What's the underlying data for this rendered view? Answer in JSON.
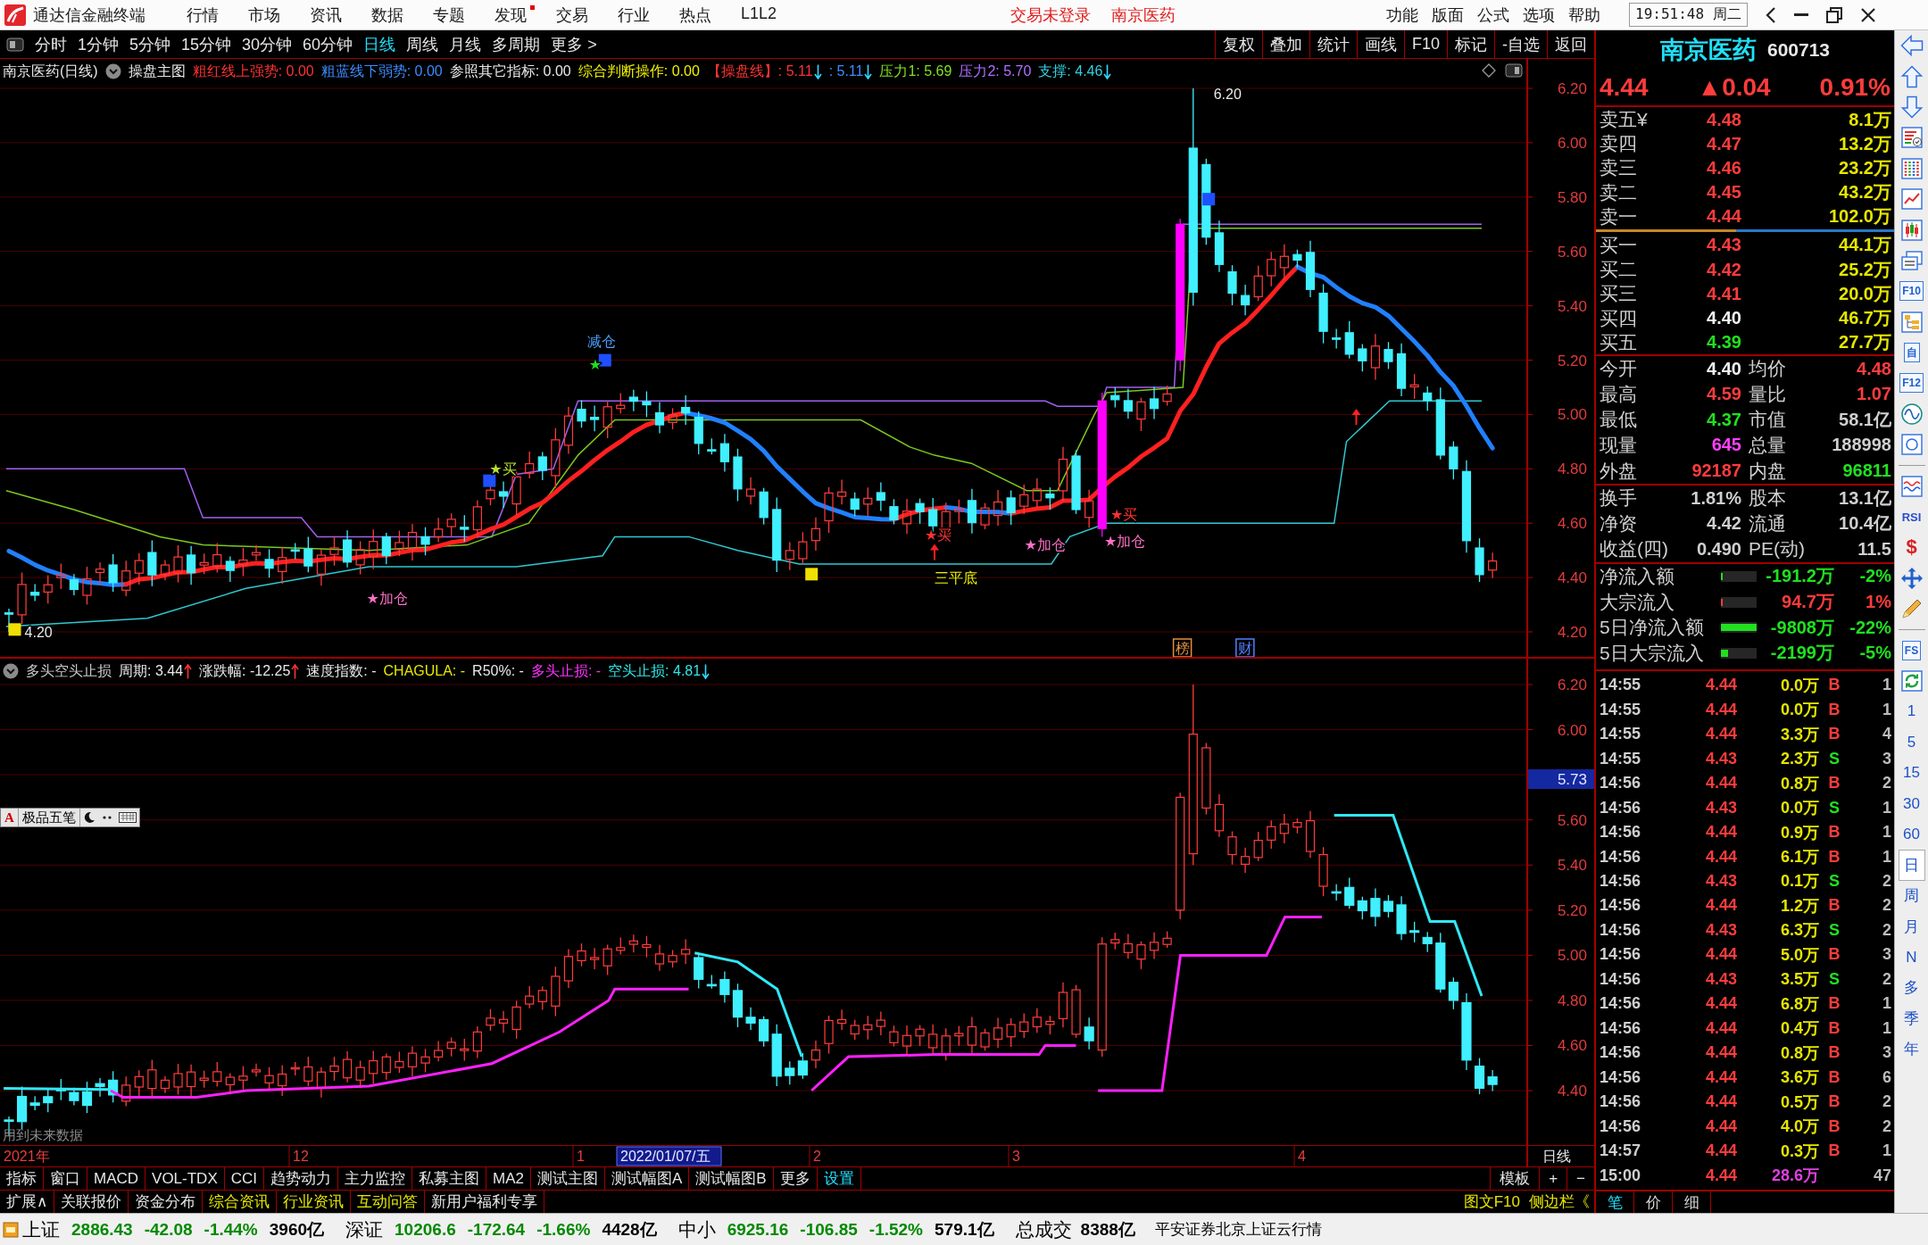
{
  "title_bar": {
    "app_name": "通达信金融终端",
    "menus": [
      {
        "label": "行情",
        "badge": false
      },
      {
        "label": "市场",
        "badge": false
      },
      {
        "label": "资讯",
        "badge": false
      },
      {
        "label": "数据",
        "badge": false
      },
      {
        "label": "专题",
        "badge": false
      },
      {
        "label": "发现",
        "badge": true
      },
      {
        "label": "交易",
        "badge": false
      },
      {
        "label": "行业",
        "badge": false
      },
      {
        "label": "热点",
        "badge": false
      },
      {
        "label": "L1L2",
        "badge": false
      }
    ],
    "notices": [
      "交易未登录",
      "南京医药"
    ],
    "system_menus": [
      "功能",
      "版面",
      "公式",
      "选项",
      "帮助"
    ],
    "clock": "19:51:48 周二"
  },
  "toolbar": {
    "periods": [
      {
        "label": "分时",
        "selected": false
      },
      {
        "label": "1分钟",
        "selected": false
      },
      {
        "label": "5分钟",
        "selected": false
      },
      {
        "label": "15分钟",
        "selected": false
      },
      {
        "label": "30分钟",
        "selected": false
      },
      {
        "label": "60分钟",
        "selected": false
      },
      {
        "label": "日线",
        "selected": true
      },
      {
        "label": "周线",
        "selected": false
      },
      {
        "label": "月线",
        "selected": false
      },
      {
        "label": "多周期",
        "selected": false
      },
      {
        "label": "更多 >",
        "selected": false
      }
    ],
    "tools": [
      "复权",
      "叠加",
      "统计",
      "画线",
      "F10",
      "标记",
      "-自选",
      "返回"
    ]
  },
  "main_chart": {
    "title": "南京医药(日线)",
    "formula": "操盘主图",
    "readouts": [
      {
        "text": "粗红线上强势: 0.00",
        "color": "#ff3232",
        "kind": "plain"
      },
      {
        "text": "粗蓝线下弱势: 0.00",
        "color": "#3c8cff",
        "kind": "plain"
      },
      {
        "text": "参照其它指标: 0.00",
        "color": "#e8e8e8",
        "kind": "plain"
      },
      {
        "text": "综合判断操作: 0.00",
        "color": "#f0f000",
        "kind": "plain"
      },
      {
        "text": "【操盘线】: 5.11",
        "color": "#ff3232",
        "kind": "falling"
      },
      {
        "text": ": 5.11",
        "color": "#3c8cff",
        "kind": "falling"
      },
      {
        "text": "压力1: 5.69",
        "color": "#80e020",
        "kind": "plain"
      },
      {
        "text": "压力2: 5.70",
        "color": "#b070ff",
        "kind": "plain"
      },
      {
        "text": "支撑: 4.46",
        "color": "#30d0e0",
        "kind": "falling"
      }
    ],
    "price_axis": [
      "6.20",
      "6.00",
      "5.80",
      "5.60",
      "5.40",
      "5.20",
      "5.00",
      "4.80",
      "4.60",
      "4.40",
      "4.20"
    ],
    "annotations": [
      {
        "kind": "price",
        "text": "6.20",
        "color": "#e8e8e8"
      },
      {
        "kind": "signal",
        "text": "减仓",
        "color": "#4aa0ff"
      },
      {
        "kind": "signal",
        "text": "★",
        "color": "#20e020"
      },
      {
        "kind": "signal",
        "text": "★买",
        "color": "#b8e030"
      },
      {
        "kind": "signal",
        "text": "★买",
        "color": "#ff3030"
      },
      {
        "kind": "signal",
        "text": "★买",
        "color": "#ff3030"
      },
      {
        "kind": "signal",
        "text": "★加仓",
        "color": "#ff70c8"
      },
      {
        "kind": "signal",
        "text": "★加仓",
        "color": "#ff70c8"
      },
      {
        "kind": "signal",
        "text": "三平底",
        "color": "#f0f000"
      },
      {
        "kind": "signal",
        "text": "★加仓",
        "color": "#ff70c8"
      },
      {
        "kind": "price",
        "text": "4.20",
        "color": "#e8e8e8"
      },
      {
        "kind": "tile",
        "text": "榜",
        "color": "#e09040"
      },
      {
        "kind": "tile",
        "text": "财",
        "color": "#5080ff"
      }
    ]
  },
  "lower_chart": {
    "title": "多头空头止损",
    "readouts": [
      {
        "text": "周期: 3.44",
        "color": "#e8e8e8",
        "kind": "rising"
      },
      {
        "text": "涨跌幅: -12.25",
        "color": "#e8e8e8",
        "kind": "rising"
      },
      {
        "text": "速度指数: -",
        "color": "#e8e8e8",
        "kind": "plain"
      },
      {
        "text": "CHAGULA: -",
        "color": "#e6e600",
        "kind": "plain"
      },
      {
        "text": "R50%: -",
        "color": "#e8e8e8",
        "kind": "plain"
      },
      {
        "text": "多头止损: -",
        "color": "#ff30ff",
        "kind": "plain"
      },
      {
        "text": "空头止损: 4.81",
        "color": "#30e6e6",
        "kind": "falling"
      }
    ],
    "price_axis": [
      "6.20",
      "6.00",
      "5.60",
      "5.40",
      "5.20",
      "5.00",
      "4.80",
      "4.60",
      "4.40"
    ],
    "cursor_price": "5.73",
    "footnote": "用到未来数据"
  },
  "ime_bar": {
    "mode": "A",
    "name": "极品五笔"
  },
  "date_axis": {
    "labels": [
      {
        "text": "2021年",
        "kind": "tick"
      },
      {
        "text": "12",
        "kind": "tick"
      },
      {
        "text": "1",
        "kind": "tick"
      },
      {
        "text": "2022/01/07/五",
        "kind": "cursor"
      },
      {
        "text": "2",
        "kind": "tick"
      },
      {
        "text": "3",
        "kind": "tick"
      },
      {
        "text": "4",
        "kind": "tick"
      }
    ],
    "period": "日线"
  },
  "indicator_tabs": {
    "tabs": [
      {
        "label": "指标",
        "kind": "tab"
      },
      {
        "label": "窗口",
        "kind": "tab"
      },
      {
        "label": "MACD",
        "kind": "tab"
      },
      {
        "label": "VOL-TDX",
        "kind": "tab"
      },
      {
        "label": "CCI",
        "kind": "tab"
      },
      {
        "label": "趋势动力",
        "kind": "tab"
      },
      {
        "label": "主力监控",
        "kind": "tab"
      },
      {
        "label": "私募主图",
        "kind": "tab"
      },
      {
        "label": "MA2",
        "kind": "tab"
      },
      {
        "label": "测试主图",
        "kind": "tab"
      },
      {
        "label": "测试幅图A",
        "kind": "tab"
      },
      {
        "label": "测试幅图B",
        "kind": "tab"
      },
      {
        "label": "更多",
        "kind": "tab"
      },
      {
        "label": "设置",
        "kind": "link"
      }
    ],
    "actions": [
      "模板",
      "+",
      "−"
    ]
  },
  "info_tabs": {
    "tabs": [
      {
        "label": "扩展∧",
        "kind": "tab"
      },
      {
        "label": "关联报价",
        "kind": "tab"
      },
      {
        "label": "资金分布",
        "kind": "tab"
      },
      {
        "label": "综合资讯",
        "kind": "info"
      },
      {
        "label": "行业资讯",
        "kind": "info"
      },
      {
        "label": "互动问答",
        "kind": "info"
      },
      {
        "label": "新用户福利专享",
        "kind": "tab"
      }
    ],
    "actions": [
      "图文F10",
      "侧边栏《"
    ]
  },
  "quote_panel": {
    "name": "南京医药",
    "code": "600713",
    "price": "4.44",
    "change": "▲0.04",
    "change_pct": "0.91%",
    "asks": [
      {
        "label": "卖五¥",
        "price": "4.48",
        "volume": "8.1万",
        "color": "#ff3c3c"
      },
      {
        "label": "卖四",
        "price": "4.47",
        "volume": "13.2万",
        "color": "#ff3c3c"
      },
      {
        "label": "卖三",
        "price": "4.46",
        "volume": "23.2万",
        "color": "#ff3c3c"
      },
      {
        "label": "卖二",
        "price": "4.45",
        "volume": "43.2万",
        "color": "#ff3c3c"
      },
      {
        "label": "卖一",
        "price": "4.44",
        "volume": "102.0万",
        "color": "#ff3c3c"
      }
    ],
    "book_ratio": {
      "level": 0.47
    },
    "bids": [
      {
        "label": "买一",
        "price": "4.43",
        "volume": "44.1万",
        "color": "#ff3c3c"
      },
      {
        "label": "买二",
        "price": "4.42",
        "volume": "25.2万",
        "color": "#ff3c3c"
      },
      {
        "label": "买三",
        "price": "4.41",
        "volume": "20.0万",
        "color": "#ff3c3c"
      },
      {
        "label": "买四",
        "price": "4.40",
        "volume": "46.7万",
        "color": "#f2f2f2"
      },
      {
        "label": "买五",
        "price": "4.39",
        "volume": "27.7万",
        "color": "#20e020"
      }
    ],
    "stats": [
      [
        {
          "label": "今开",
          "value": "4.40",
          "color": "#f2f2f2"
        },
        {
          "label": "均价",
          "value": "4.48",
          "color": "#ff3c3c"
        }
      ],
      [
        {
          "label": "最高",
          "value": "4.59",
          "color": "#ff3c3c"
        },
        {
          "label": "量比",
          "value": "1.07",
          "color": "#ff3c3c"
        }
      ],
      [
        {
          "label": "最低",
          "value": "4.37",
          "color": "#20e020"
        },
        {
          "label": "市值",
          "value": "58.1亿",
          "color": "#cfcfcf"
        }
      ],
      [
        {
          "label": "现量",
          "value": "645",
          "color": "#ff40ff"
        },
        {
          "label": "总量",
          "value": "188998",
          "color": "#cfcfcf"
        }
      ],
      [
        {
          "label": "外盘",
          "value": "92187",
          "color": "#ff3c3c"
        },
        {
          "label": "内盘",
          "value": "96811",
          "color": "#20e020"
        }
      ]
    ],
    "ratios": [
      [
        {
          "label": "换手",
          "value": "1.81%"
        },
        {
          "label": "股本",
          "value": "13.1亿"
        }
      ],
      [
        {
          "label": "净资",
          "value": "4.42"
        },
        {
          "label": "流通",
          "value": "10.4亿"
        }
      ],
      [
        {
          "label": "收益(四)",
          "value": "0.490"
        },
        {
          "label": "PE(动)",
          "value": "11.5"
        }
      ]
    ],
    "fund_flows": [
      {
        "label": "净流入额",
        "level": 0.04,
        "amount": "-191.2万",
        "percent": "-2%",
        "color": "#20e020"
      },
      {
        "label": "大宗流入",
        "level": 0.04,
        "amount": "94.7万",
        "percent": "1%",
        "color": "#ff3c3c"
      },
      {
        "label": "5日净流入额",
        "level": 1,
        "amount": "-9808万",
        "percent": "-22%",
        "color": "#20e020"
      },
      {
        "label": "5日大宗流入",
        "level": 0.2,
        "amount": "-2199万",
        "percent": "-5%",
        "color": "#20e020"
      }
    ],
    "ticks": [
      {
        "time": "14:55",
        "price": "4.44",
        "volume": "0.0万",
        "flag": "B",
        "kind": "buy",
        "count": "1"
      },
      {
        "time": "14:55",
        "price": "4.44",
        "volume": "0.0万",
        "flag": "B",
        "kind": "buy",
        "count": "1"
      },
      {
        "time": "14:55",
        "price": "4.44",
        "volume": "3.3万",
        "flag": "B",
        "kind": "buy",
        "count": "4"
      },
      {
        "time": "14:55",
        "price": "4.43",
        "volume": "2.3万",
        "flag": "S",
        "kind": "sell",
        "count": "3"
      },
      {
        "time": "14:56",
        "price": "4.44",
        "volume": "0.8万",
        "flag": "B",
        "kind": "buy",
        "count": "2"
      },
      {
        "time": "14:56",
        "price": "4.43",
        "volume": "0.0万",
        "flag": "S",
        "kind": "sell",
        "count": "1"
      },
      {
        "time": "14:56",
        "price": "4.44",
        "volume": "0.9万",
        "flag": "B",
        "kind": "buy",
        "count": "1"
      },
      {
        "time": "14:56",
        "price": "4.44",
        "volume": "6.1万",
        "flag": "B",
        "kind": "buy",
        "count": "1"
      },
      {
        "time": "14:56",
        "price": "4.43",
        "volume": "0.1万",
        "flag": "S",
        "kind": "sell",
        "count": "2"
      },
      {
        "time": "14:56",
        "price": "4.44",
        "volume": "1.2万",
        "flag": "B",
        "kind": "buy",
        "count": "2"
      },
      {
        "time": "14:56",
        "price": "4.43",
        "volume": "6.3万",
        "flag": "S",
        "kind": "sell",
        "count": "2"
      },
      {
        "time": "14:56",
        "price": "4.44",
        "volume": "5.0万",
        "flag": "B",
        "kind": "buy",
        "count": "3"
      },
      {
        "time": "14:56",
        "price": "4.43",
        "volume": "3.5万",
        "flag": "S",
        "kind": "sell",
        "count": "2"
      },
      {
        "time": "14:56",
        "price": "4.44",
        "volume": "6.8万",
        "flag": "B",
        "kind": "buy",
        "count": "1"
      },
      {
        "time": "14:56",
        "price": "4.44",
        "volume": "0.4万",
        "flag": "B",
        "kind": "buy",
        "count": "1"
      },
      {
        "time": "14:56",
        "price": "4.44",
        "volume": "0.8万",
        "flag": "B",
        "kind": "buy",
        "count": "3"
      },
      {
        "time": "14:56",
        "price": "4.44",
        "volume": "3.6万",
        "flag": "B",
        "kind": "buy",
        "count": "6"
      },
      {
        "time": "14:56",
        "price": "4.44",
        "volume": "0.5万",
        "flag": "B",
        "kind": "buy",
        "count": "2"
      },
      {
        "time": "14:56",
        "price": "4.44",
        "volume": "4.0万",
        "flag": "B",
        "kind": "buy",
        "count": "2"
      },
      {
        "time": "14:57",
        "price": "4.44",
        "volume": "0.3万",
        "flag": "B",
        "kind": "buy",
        "count": "1"
      },
      {
        "time": "15:00",
        "price": "4.44",
        "volume": "28.6万",
        "kind": "close",
        "count": "47"
      }
    ],
    "detail_tabs": [
      {
        "label": "笔",
        "selected": true
      },
      {
        "label": "价",
        "selected": false
      },
      {
        "label": "细",
        "selected": false
      }
    ]
  },
  "side_bar": {
    "labels": [
      "F10",
      "自",
      "F12",
      "RSI",
      "$",
      "FS"
    ],
    "periods": [
      {
        "label": "1",
        "selected": false
      },
      {
        "label": "5",
        "selected": false
      },
      {
        "label": "15",
        "selected": false
      },
      {
        "label": "30",
        "selected": false
      },
      {
        "label": "60",
        "selected": false
      },
      {
        "label": "日",
        "selected": true
      },
      {
        "label": "周",
        "selected": false
      },
      {
        "label": "月",
        "selected": false
      },
      {
        "label": "N",
        "selected": false
      },
      {
        "label": "多",
        "selected": false
      },
      {
        "label": "季",
        "selected": false
      },
      {
        "label": "年",
        "selected": false
      }
    ]
  },
  "status_bar": {
    "indices": [
      {
        "name": "上证",
        "value": "2886.43",
        "change": "-42.08",
        "percent": "-1.44%",
        "turnover": "3960亿"
      },
      {
        "name": "深证",
        "value": "10206.6",
        "change": "-172.64",
        "percent": "-1.66%",
        "turnover": "4428亿"
      },
      {
        "name": "中小",
        "value": "6925.16",
        "change": "-106.85",
        "percent": "-1.52%",
        "turnover": "579.1亿"
      }
    ],
    "total_label": "总成交",
    "total": "8388亿",
    "feed": "平安证券北京上证云行情"
  }
}
